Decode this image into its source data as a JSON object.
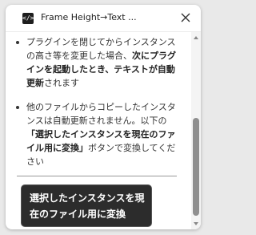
{
  "window": {
    "title": "Frame Height→Text ...",
    "icon": "code-icon",
    "icon_glyph": "</>"
  },
  "content": {
    "items": [
      {
        "parts": [
          {
            "text": "プラグインを閉じてからインスタンスの高さ等を変更した場合、",
            "bold": false
          },
          {
            "text": "次にプラグインを起動したとき、テキストが自動更新",
            "bold": true
          },
          {
            "text": "されます",
            "bold": false
          }
        ]
      },
      {
        "parts": [
          {
            "text": "他のファイルからコピーしたインスタンスは自動更新されません。以下の",
            "bold": false
          },
          {
            "text": "「選択したインスタンスを現在のファイル用に変換」",
            "bold": true
          },
          {
            "text": "ボタンで変換してください",
            "bold": false
          }
        ]
      }
    ],
    "convert_button_label": "選択したインスタンスを現在のファイル用に変換"
  },
  "colors": {
    "button_bg": "#2c2c2c",
    "button_text": "#ffffff"
  }
}
